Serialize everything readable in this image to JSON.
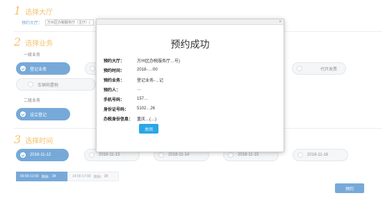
{
  "step1": {
    "num": "1",
    "title": "选择大厅"
  },
  "hall": {
    "label": "预约大厅：",
    "value": "万州区办税服务厅（主厅）("
  },
  "step2": {
    "num": "2",
    "title": "选择业务"
  },
  "level1": {
    "label": "一级业务"
  },
  "level1_items": [
    {
      "label": "登记业务",
      "active": true
    },
    {
      "label": "",
      "active": false
    },
    {
      "label": "代开发票",
      "active": false
    },
    {
      "label": "车辆购置税",
      "active": false
    }
  ],
  "level2": {
    "label": "二级业务"
  },
  "level2_items": [
    {
      "label": "设立登记",
      "active": true
    }
  ],
  "step3": {
    "num": "3",
    "title": "选择时间"
  },
  "dates": [
    {
      "label": "2018-11-12",
      "active": true
    },
    {
      "label": "2018-11-13",
      "active": false
    },
    {
      "label": "2018-11-14",
      "active": false
    },
    {
      "label": "2018-11-15",
      "active": false
    },
    {
      "label": "2018-11-16",
      "active": false
    }
  ],
  "slots": [
    {
      "time": "09:00-12:00",
      "remain_label": "剩余：",
      "remain": "28",
      "selected": true
    },
    {
      "time": "14:00-17:00",
      "remain_label": "剩余：",
      "remain": "28",
      "selected": false
    }
  ],
  "book_button": "预约",
  "modal": {
    "close_icon": "×",
    "title": "预约成功",
    "rows": [
      {
        "label": "预约大厅：",
        "value": "万州区办税服务厅…号)"
      },
      {
        "label": "预约时间：",
        "value": "2018-…:00"
      },
      {
        "label": "预约业务：",
        "value": "登记业务-…记"
      },
      {
        "label": "预约人：",
        "value": "…"
      },
      {
        "label": "手机号码：",
        "value": "157…"
      },
      {
        "label": "身份证号码：",
        "value": "5102…26"
      },
      {
        "label": "办税身份信息：",
        "value": "重庆…(…)"
      }
    ],
    "button": "关闭"
  },
  "colors": {
    "accent": "#2e7bc3",
    "step": "#f0a020",
    "modal_button": "#2aa7e4",
    "remain_red": "#e03131"
  }
}
